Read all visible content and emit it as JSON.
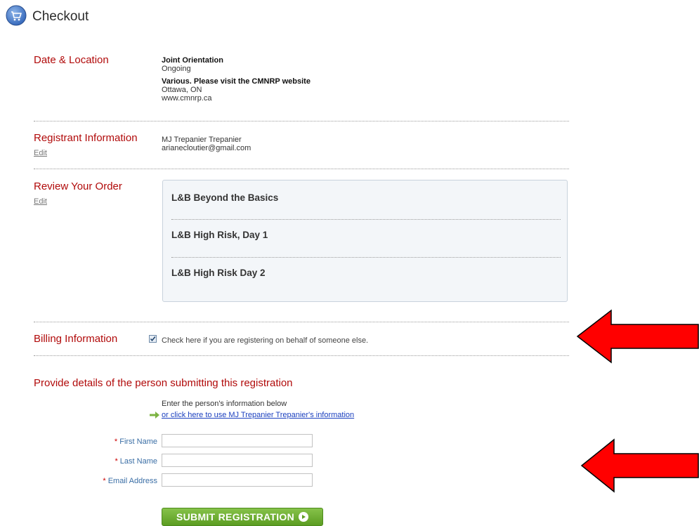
{
  "header": {
    "title": "Checkout"
  },
  "date_location": {
    "label": "Date & Location",
    "event_name": "Joint Orientation",
    "event_date": "Ongoing",
    "venue": "Various. Please visit the CMNRP website",
    "city": "Ottawa, ON",
    "website": "www.cmnrp.ca"
  },
  "registrant": {
    "label": "Registrant Information",
    "edit": "Edit",
    "name": "MJ Trepanier Trepanier",
    "email": "arianecloutier@gmail.com"
  },
  "review": {
    "label": "Review Your Order",
    "edit": "Edit",
    "items": [
      "L&B Beyond the Basics",
      "L&B High Risk, Day 1",
      "L&B High Risk Day 2"
    ]
  },
  "billing": {
    "label": "Billing Information",
    "checkbox_checked": true,
    "checkbox_text": "Check here if you are registering on behalf of someone else."
  },
  "provide": {
    "title": "Provide details of the person submitting this registration",
    "intro": "Enter the person's information below",
    "link": "or click here to use MJ Trepanier Trepanier's information"
  },
  "form": {
    "required_mark": "*",
    "first_name": {
      "label": "First Name",
      "value": ""
    },
    "last_name": {
      "label": "Last Name",
      "value": ""
    },
    "email": {
      "label": "Email Address",
      "value": ""
    }
  },
  "submit": {
    "label": "SUBMIT REGISTRATION"
  },
  "colors": {
    "section_red": "#b10a0a",
    "link_blue": "#1a3fbf",
    "annotation_red": "#ff0000",
    "button_green": "#6aaa30"
  }
}
